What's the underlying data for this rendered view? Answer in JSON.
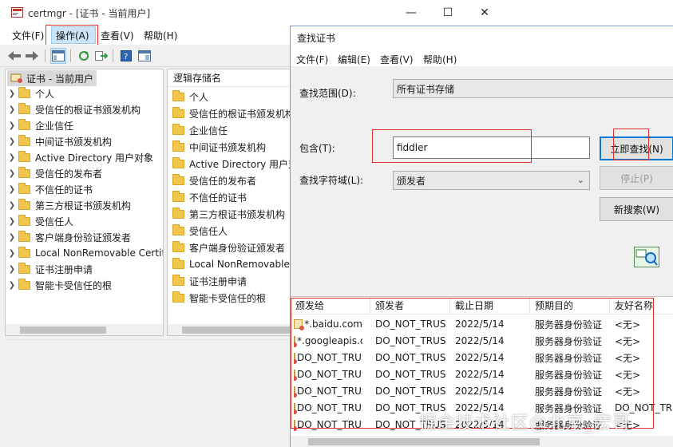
{
  "main": {
    "title": "certmgr - [证书 - 当前用户]",
    "menu": [
      "文件(F)",
      "操作(A)",
      "查看(V)",
      "帮助(H)"
    ],
    "tree_root": "证书 - 当前用户",
    "tree_items": [
      "个人",
      "受信任的根证书颁发机构",
      "企业信任",
      "中间证书颁发机构",
      "Active Directory 用户对象",
      "受信任的发布者",
      "不信任的证书",
      "第三方根证书颁发机构",
      "受信任人",
      "客户端身份验证颁发者",
      "Local NonRemovable Certificates",
      "证书注册申请",
      "智能卡受信任的根"
    ],
    "list_header": "逻辑存储名",
    "list_items": [
      "个人",
      "受信任的根证书颁发机构",
      "企业信任",
      "中间证书颁发机构",
      "Active Directory 用户对象",
      "受信任的发布者",
      "不信任的证书",
      "第三方根证书颁发机构",
      "受信任人",
      "客户端身份验证颁发者",
      "Local NonRemovable Certificates",
      "证书注册申请",
      "智能卡受信任的根"
    ]
  },
  "dialog": {
    "title": "查找证书",
    "menu": [
      "文件(F)",
      "编辑(E)",
      "查看(V)",
      "帮助(H)"
    ],
    "scope_label": "查找范围(D):",
    "scope_value": "所有证书存储",
    "contains_label": "包含(T):",
    "contains_value": "fiddler",
    "field_label": "查找字符域(L):",
    "field_value": "颁发者",
    "find_now": "立即查找(N)",
    "stop": "停止(P)",
    "new_search": "新搜索(W)",
    "columns": [
      "颁发给",
      "颁发者",
      "截止日期",
      "预期目的",
      "友好名称"
    ],
    "rows": [
      [
        "*.baidu.com",
        "DO_NOT_TRUST_FiddlerRoot",
        "2022/5/14",
        "服务器身份验证",
        "<无>"
      ],
      [
        "*.googleapis.com",
        "DO_NOT_TRUST_FiddlerRoot",
        "2022/5/14",
        "服务器身份验证",
        "<无>"
      ],
      [
        "DO_NOT_TRUST_FiddlerRoot",
        "DO_NOT_TRUST_FiddlerRoot",
        "2022/5/14",
        "服务器身份验证",
        "<无>"
      ],
      [
        "DO_NOT_TRUST_FiddlerRoot",
        "DO_NOT_TRUST_FiddlerRoot",
        "2022/5/14",
        "服务器身份验证",
        "<无>"
      ],
      [
        "DO_NOT_TRUST_FiddlerRoot",
        "DO_NOT_TRUST_FiddlerRoot",
        "2022/5/14",
        "服务器身份验证",
        "<无>"
      ],
      [
        "DO_NOT_TRUST_FiddlerRoot",
        "DO_NOT_TRUST_FiddlerRoot",
        "2022/5/14",
        "服务器身份验证",
        "DO_NOT_TRUST"
      ],
      [
        "DO_NOT_TRUST_FiddlerRoot",
        "DO_NOT_TRUST_FiddlerRoot",
        "2022/5/14",
        "服务器身份验证",
        "<无>"
      ]
    ]
  },
  "watermark": "掘金技术社区@北京_宏哥",
  "colors": {
    "highlight": "#cce4f7",
    "annotation": "#e03030",
    "accent": "#0078d7"
  }
}
